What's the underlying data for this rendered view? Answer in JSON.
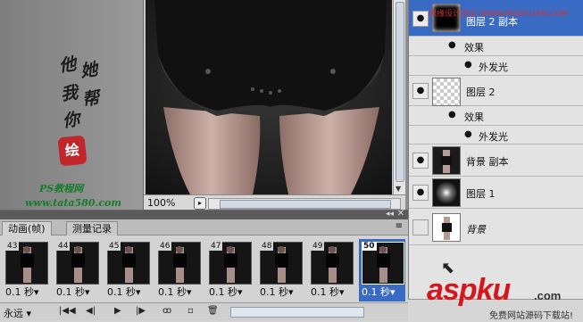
{
  "document": {
    "zoom": "100%"
  },
  "watermark_left": {
    "calligraphy": [
      "他",
      "她",
      "我",
      "帮",
      "你"
    ],
    "seal_text": "绘",
    "site_name": "PS教程网",
    "url": "www.tata580.com"
  },
  "watermark_top": "思缘设计论坛 WWW.MISSYUAN.COM",
  "layers": [
    {
      "name": "图层 2 副本",
      "selected": true,
      "thumb": "black-glow"
    },
    {
      "name": "效果",
      "kind": "effects-header"
    },
    {
      "name": "外发光",
      "kind": "effect"
    },
    {
      "name": "图层 2",
      "thumb": "transparent"
    },
    {
      "name": "效果",
      "kind": "effects-header"
    },
    {
      "name": "外发光",
      "kind": "effect"
    },
    {
      "name": "背景 副本",
      "thumb": "photo"
    },
    {
      "name": "图层 1",
      "thumb": "glow"
    },
    {
      "name": "背景",
      "thumb": "photo",
      "italic": true
    }
  ],
  "animation": {
    "tabs": [
      "动画(帧)",
      "测量记录"
    ],
    "frames": [
      {
        "num": "43",
        "delay": "0.1 秒▾"
      },
      {
        "num": "44",
        "delay": "0.1 秒▾"
      },
      {
        "num": "45",
        "delay": "0.1 秒▾"
      },
      {
        "num": "46",
        "delay": "0.1 秒▾"
      },
      {
        "num": "47",
        "delay": "0.1 秒▾"
      },
      {
        "num": "48",
        "delay": "0.1 秒▾"
      },
      {
        "num": "49",
        "delay": "0.1 秒▾"
      },
      {
        "num": "50",
        "delay": "0.1 秒▾",
        "selected": true
      }
    ],
    "loop": "永远 ▾",
    "controls": [
      "|◀◀",
      "◀|",
      "▶",
      "|▶",
      "ꝏ",
      "▫",
      "🗑"
    ]
  },
  "branding": {
    "logo": "aspku",
    "domain": ".com",
    "tagline": "免费网站源码下载站!"
  },
  "colors": {
    "selection": "#3a6bc4",
    "watermark_red": "#d4171c",
    "watermark_green": "#147d2a"
  }
}
